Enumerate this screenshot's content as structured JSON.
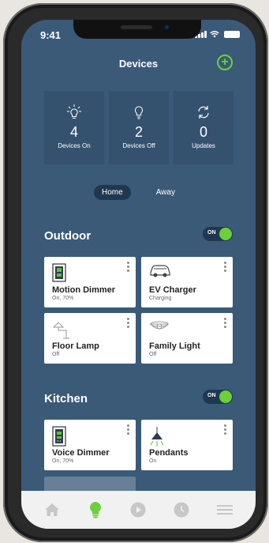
{
  "status_bar": {
    "time": "9:41"
  },
  "header": {
    "title": "Devices"
  },
  "stats": [
    {
      "icon": "bulb-on-icon",
      "value": "4",
      "label": "Devices On"
    },
    {
      "icon": "bulb-off-icon",
      "value": "2",
      "label": "Devices Off"
    },
    {
      "icon": "refresh-icon",
      "value": "0",
      "label": "Updates"
    }
  ],
  "mode": {
    "options": [
      "Home",
      "Away"
    ],
    "selected": "Home"
  },
  "sections": [
    {
      "title": "Outdoor",
      "toggle": "ON",
      "devices": [
        {
          "name": "Motion Dimmer",
          "status": "On, 70%",
          "icon": "motion-dimmer-icon"
        },
        {
          "name": "EV Charger",
          "status": "Charging",
          "icon": "car-icon"
        },
        {
          "name": "Floor Lamp",
          "status": "Off",
          "icon": "floor-lamp-icon"
        },
        {
          "name": "Family Light",
          "status": "Off",
          "icon": "ceiling-light-icon"
        }
      ]
    },
    {
      "title": "Kitchen",
      "toggle": "ON",
      "devices": [
        {
          "name": "Voice Dimmer",
          "status": "On, 70%",
          "icon": "voice-dimmer-icon"
        },
        {
          "name": "Pendants",
          "status": "On",
          "icon": "pendant-icon"
        }
      ]
    }
  ],
  "tabbar": [
    {
      "icon": "home-icon"
    },
    {
      "icon": "bulb-icon",
      "active": true
    },
    {
      "icon": "play-icon"
    },
    {
      "icon": "clock-icon"
    },
    {
      "icon": "menu-icon"
    }
  ],
  "colors": {
    "background": "#3a5a78",
    "accent": "#6bd03a",
    "tile": "#34526e",
    "card": "#ffffff"
  }
}
